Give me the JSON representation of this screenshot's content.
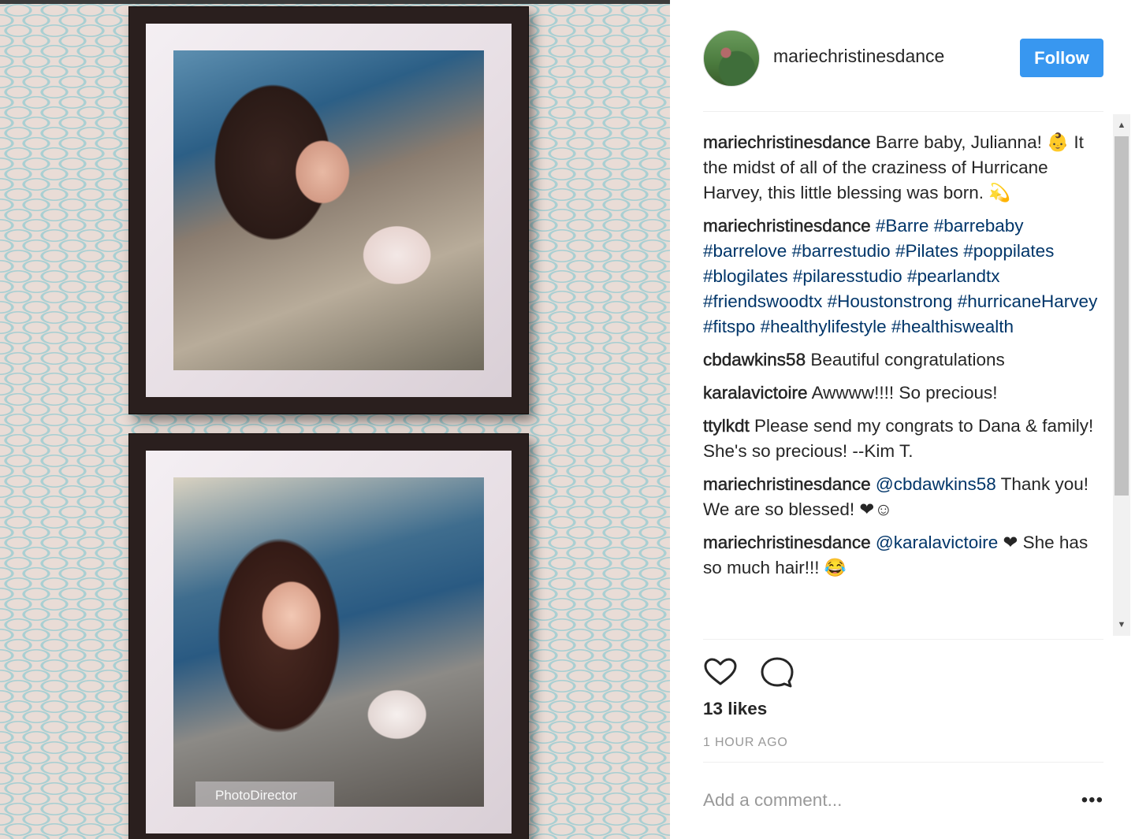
{
  "post": {
    "username": "mariechristinesdance",
    "follow_label": "Follow",
    "watermark": "PhotoDirector",
    "comments": [
      {
        "author": "mariechristinesdance",
        "text": "Barre baby, Julianna! 👶 It the midst of all of the craziness of Hurricane Harvey, this little blessing was born. 💫",
        "hashtags": []
      },
      {
        "author": "mariechristinesdance",
        "text": "",
        "hashtags": [
          "#Barre",
          "#barrebaby",
          "#barrelove",
          "#barrestudio",
          "#Pilates",
          "#poppilates",
          "#blogilates",
          "#pilaresstudio",
          "#pearlandtx",
          "#friendswoodtx",
          "#Houstonstrong",
          "#hurricaneHarvey",
          "#fitspo",
          "#healthylifestyle",
          "#healthiswealth"
        ]
      },
      {
        "author": "cbdawkins58",
        "text": "Beautiful congratulations"
      },
      {
        "author": "karalavictoire",
        "text": "Awwww!!!! So precious!"
      },
      {
        "author": "ttylkdt",
        "text": "Please send my congrats to Dana & family! She's so precious! --Kim T."
      },
      {
        "author": "mariechristinesdance",
        "mention": "@cbdawkins58",
        "text": "Thank you! We are so blessed! ❤☺"
      },
      {
        "author": "mariechristinesdance",
        "mention": "@karalavictoire",
        "text": "❤ She has so much hair!!! 😂"
      }
    ],
    "likes": "13 likes",
    "time_ago": "1 HOUR AGO",
    "comment_placeholder": "Add a comment...",
    "icons": [
      "heart-icon",
      "comment-icon",
      "more-icon"
    ]
  }
}
